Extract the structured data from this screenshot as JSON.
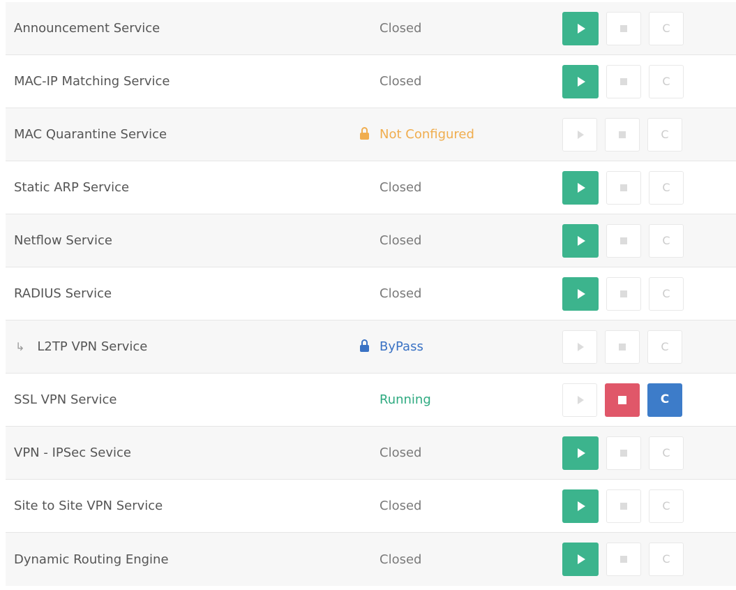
{
  "colors": {
    "start": "#3cb48d",
    "stop": "#e05769",
    "restart": "#3d7cc9",
    "not_configured": "#f0ad4e",
    "bypass": "#3a72c4",
    "running": "#2eaa80"
  },
  "icons": {
    "start": "play-icon",
    "stop": "stop-icon",
    "restart": "refresh-icon",
    "lock": "lock-icon",
    "child": "child-arrow-icon"
  },
  "restart_glyph": "C",
  "child_arrow": "↳",
  "services": [
    {
      "name": "Announcement Service",
      "status": "Closed"
    },
    {
      "name": "MAC-IP Matching Service",
      "status": "Closed"
    },
    {
      "name": "MAC Quarantine Service",
      "status": "Not Configured"
    },
    {
      "name": "Static ARP Service",
      "status": "Closed"
    },
    {
      "name": "Netflow Service",
      "status": "Closed"
    },
    {
      "name": "RADIUS Service",
      "status": "Closed"
    },
    {
      "name": "L2TP VPN Service",
      "status": "ByPass"
    },
    {
      "name": "SSL VPN Service",
      "status": "Running"
    },
    {
      "name": "VPN - IPSec Sevice",
      "status": "Closed"
    },
    {
      "name": "Site to Site VPN Service",
      "status": "Closed"
    },
    {
      "name": "Dynamic Routing Engine",
      "status": "Closed"
    }
  ]
}
